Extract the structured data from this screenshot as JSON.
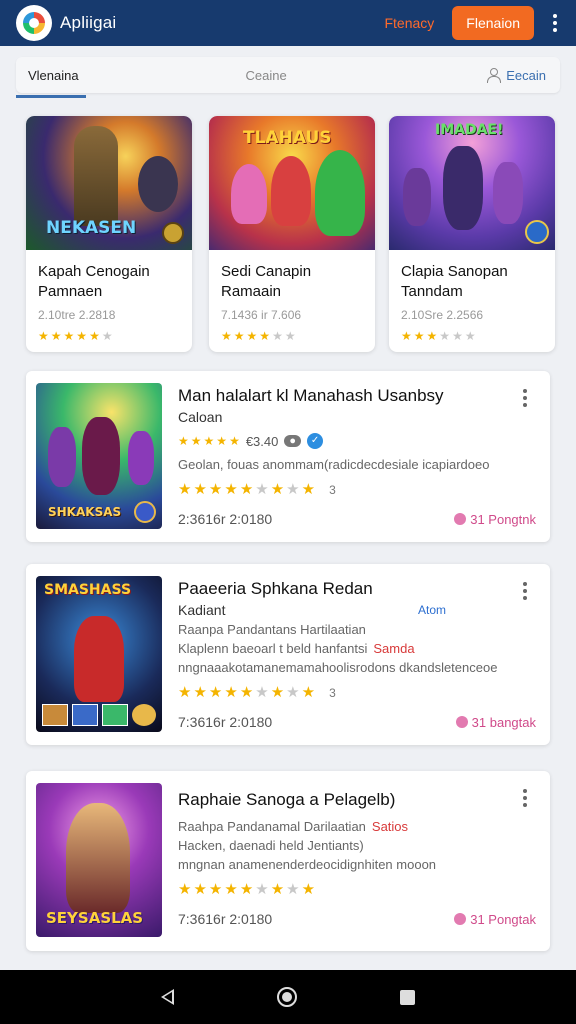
{
  "header": {
    "app_name": "Apliigai",
    "link_label": "Ftenacy",
    "button_label": "Flenaion"
  },
  "tabs": {
    "active": "Vlenaina",
    "middle": "Ceaine",
    "right": "Eecain"
  },
  "featured": [
    {
      "art_label": "NEKASEN",
      "title": "Kapah Cenogain Pamnaen",
      "meta": "2.10tre 2.2818",
      "rating": 4.5
    },
    {
      "art_label": "TLAHAUS",
      "title": "Sedi Canapin Ramaain",
      "meta": "7.1436 ir 7.606",
      "rating": 3.5
    },
    {
      "art_label": "IMADAE!",
      "title": "Clapia Sanopan Tanndam",
      "meta": "2.10Sre 2.2566",
      "rating": 3.0
    }
  ],
  "list": [
    {
      "title": "Man  halalart kl Manahash Usanbsy",
      "subtitle": "Caloan",
      "rating_text": "€3.40",
      "desc_lines": [
        "Geolan, fouas anommam(radicdecdesiale icapiardoeo"
      ],
      "rating": 3.5,
      "rating_count": "3",
      "date": "2:3616r 2:0180",
      "tag": "31 Pongtnk",
      "art_label": "SHKAKSAS"
    },
    {
      "title": "Paaeeria Sphkana Redan",
      "subtitle": "Kadiant",
      "right_tag": "Atom",
      "desc_lines": [
        "Raanpa Pandantans Hartilaatian",
        "Klaplenn baeoarl t beld hanfantsi",
        "nngnaaakotamanemamahoolisrodons dkandsletenceoe"
      ],
      "inline_tag": "Samda",
      "rating": 3.5,
      "rating_count": "3",
      "date": "7:3616r 2:0180",
      "tag": "31 bangtak",
      "art_label": "SMASHASS"
    },
    {
      "title": "Raphaie Sanoga a Pelagelb)",
      "subtitle": "",
      "desc_lines": [
        "Raahpa Pandanamal Darilaatian",
        "Hacken, daenadi held Jentiants)",
        "mngnan anamenenderdeocidignhiten mooon"
      ],
      "inline_tag": "Satios",
      "rating": 3.5,
      "rating_count": "",
      "date": "7:3616r 2:0180",
      "tag": "31 Pongtak",
      "art_label": "SEYSASLAS"
    }
  ]
}
